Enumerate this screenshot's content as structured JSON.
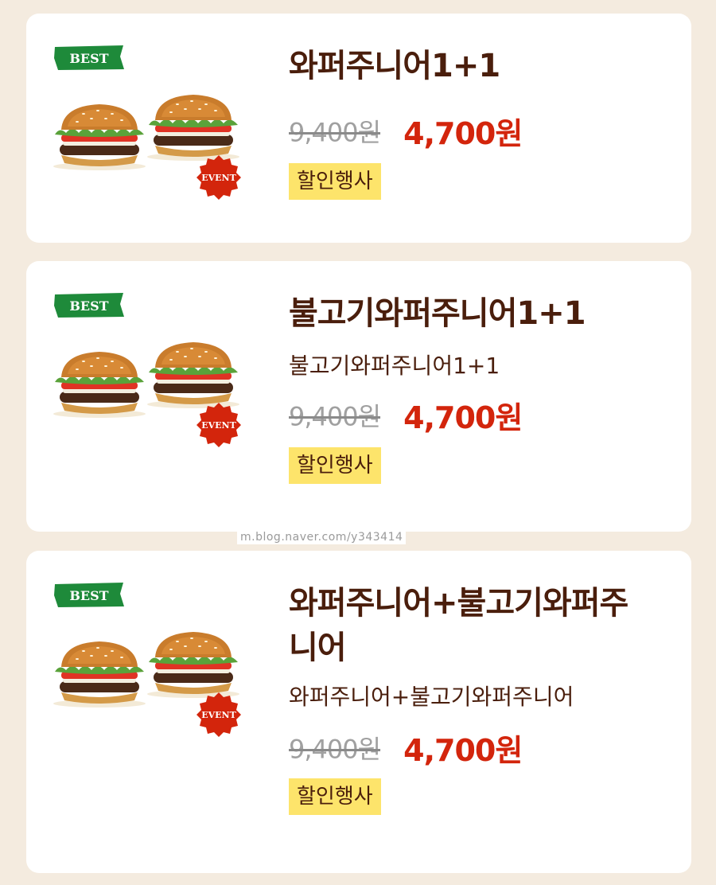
{
  "products": [
    {
      "best_label": "BEST",
      "event_label": "EVENT",
      "title": "와퍼주니어1+1",
      "subtitle": "",
      "original_price": "9,400원",
      "sale_price": "4,700원",
      "badge": "할인행사"
    },
    {
      "best_label": "BEST",
      "event_label": "EVENT",
      "title": "불고기와퍼주니어1+1",
      "subtitle": "불고기와퍼주니어1+1",
      "original_price": "9,400원",
      "sale_price": "4,700원",
      "badge": "할인행사"
    },
    {
      "best_label": "BEST",
      "event_label": "EVENT",
      "title": "와퍼주니어+불고기와퍼주니어",
      "subtitle": "와퍼주니어+불고기와퍼주니어",
      "original_price": "9,400원",
      "sale_price": "4,700원",
      "badge": "할인행사"
    }
  ],
  "watermark": "m.blog.naver.com/y343414",
  "colors": {
    "background": "#f4ebdf",
    "title": "#4a1e0c",
    "sale_price": "#d3250c",
    "badge_bg": "#fde46b",
    "best_badge": "#1e8a3a",
    "event_badge": "#d3250c"
  }
}
